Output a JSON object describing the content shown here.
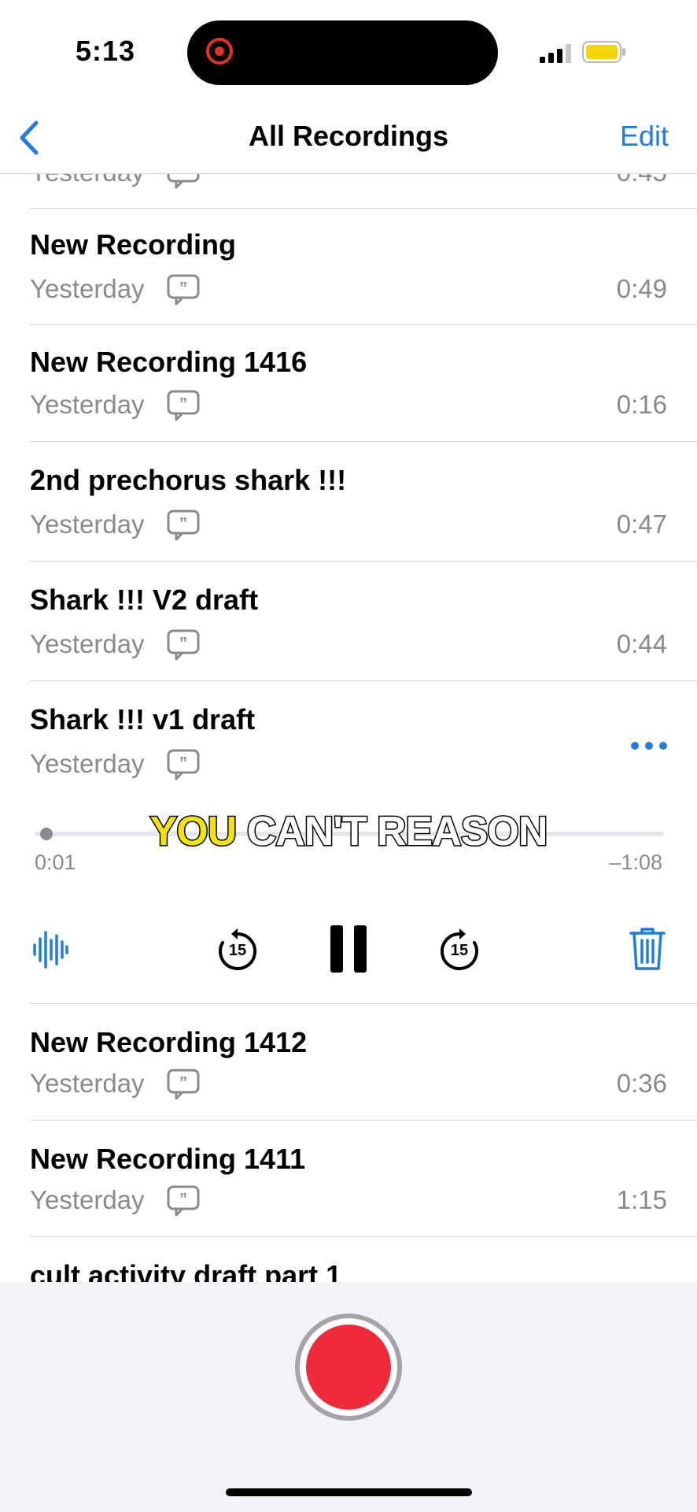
{
  "status_bar": {
    "time": "5:13"
  },
  "nav": {
    "title": "All Recordings",
    "edit_label": "Edit"
  },
  "recordings": [
    {
      "title": "",
      "date": "Yesterday",
      "duration": "0:45"
    },
    {
      "title": "New Recording",
      "date": "Yesterday",
      "duration": "0:49"
    },
    {
      "title": "New Recording 1416",
      "date": "Yesterday",
      "duration": "0:16"
    },
    {
      "title": "2nd prechorus shark !!!",
      "date": "Yesterday",
      "duration": "0:47"
    },
    {
      "title": "Shark !!! V2 draft",
      "date": "Yesterday",
      "duration": "0:44"
    },
    {
      "title": "Shark !!! v1 draft",
      "date": "Yesterday",
      "duration": ""
    },
    {
      "title": "New Recording 1412",
      "date": "Yesterday",
      "duration": "0:36"
    },
    {
      "title": "New Recording 1411",
      "date": "Yesterday",
      "duration": "1:15"
    },
    {
      "title": "cult activity draft part 1",
      "date": "",
      "duration": ""
    }
  ],
  "player": {
    "elapsed": "0:01",
    "remaining": "–1:08",
    "progress": 0.014,
    "skip_back_seconds": "15",
    "skip_forward_seconds": "15"
  },
  "caption": {
    "highlight": "YOU",
    "rest": "CAN'T REASON"
  },
  "colors": {
    "accent": "#1f7ce0",
    "record": "#ef2b3b",
    "secondary_text": "#8a8a8e",
    "caption_highlight": "#f2e400"
  }
}
